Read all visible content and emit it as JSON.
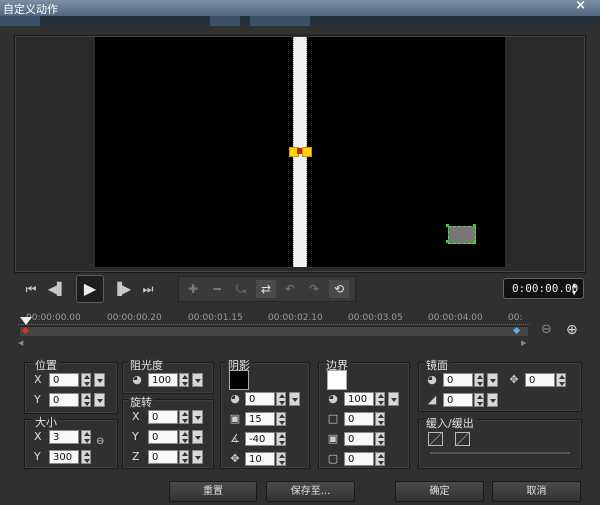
{
  "window": {
    "title": "自定义动作",
    "close_glyph": "×"
  },
  "timecode": "0:00:00.00",
  "ruler_ticks": [
    "00:00:00.00",
    "00:00:00.20",
    "00:00:01.15",
    "00:00:02.10",
    "00:00:03.05",
    "00:00:04.00",
    "00:"
  ],
  "position": {
    "title": "位置",
    "x_label": "X",
    "x_value": "0",
    "y_label": "Y",
    "y_value": "0"
  },
  "size": {
    "title": "大小",
    "x_label": "X",
    "x_value": "3",
    "y_label": "Y",
    "y_value": "300"
  },
  "opacity": {
    "title": "阻光度",
    "value": "100"
  },
  "rotation": {
    "title": "旋转",
    "x_label": "X",
    "x_value": "0",
    "y_label": "Y",
    "y_value": "0",
    "z_label": "Z",
    "z_value": "0"
  },
  "shadow": {
    "title": "阴影",
    "color": "#000000",
    "opacity_value": "0",
    "blur_value": "15",
    "angle_value": "-40",
    "distance_value": "10"
  },
  "border": {
    "title": "边界",
    "color": "#ffffff",
    "opacity_value": "100",
    "width_value": "0",
    "val2": "0",
    "val3": "0"
  },
  "mirror": {
    "title": "镜面",
    "value1": "0",
    "value2": "0",
    "value3": "0"
  },
  "fade": {
    "title": "缓入/缓出"
  },
  "buttons": {
    "reset": "重置",
    "save_to": "保存至...",
    "ok": "确定",
    "cancel": "取消"
  },
  "colors": {
    "accent": "#ffd400",
    "selection": "#55dd55"
  }
}
